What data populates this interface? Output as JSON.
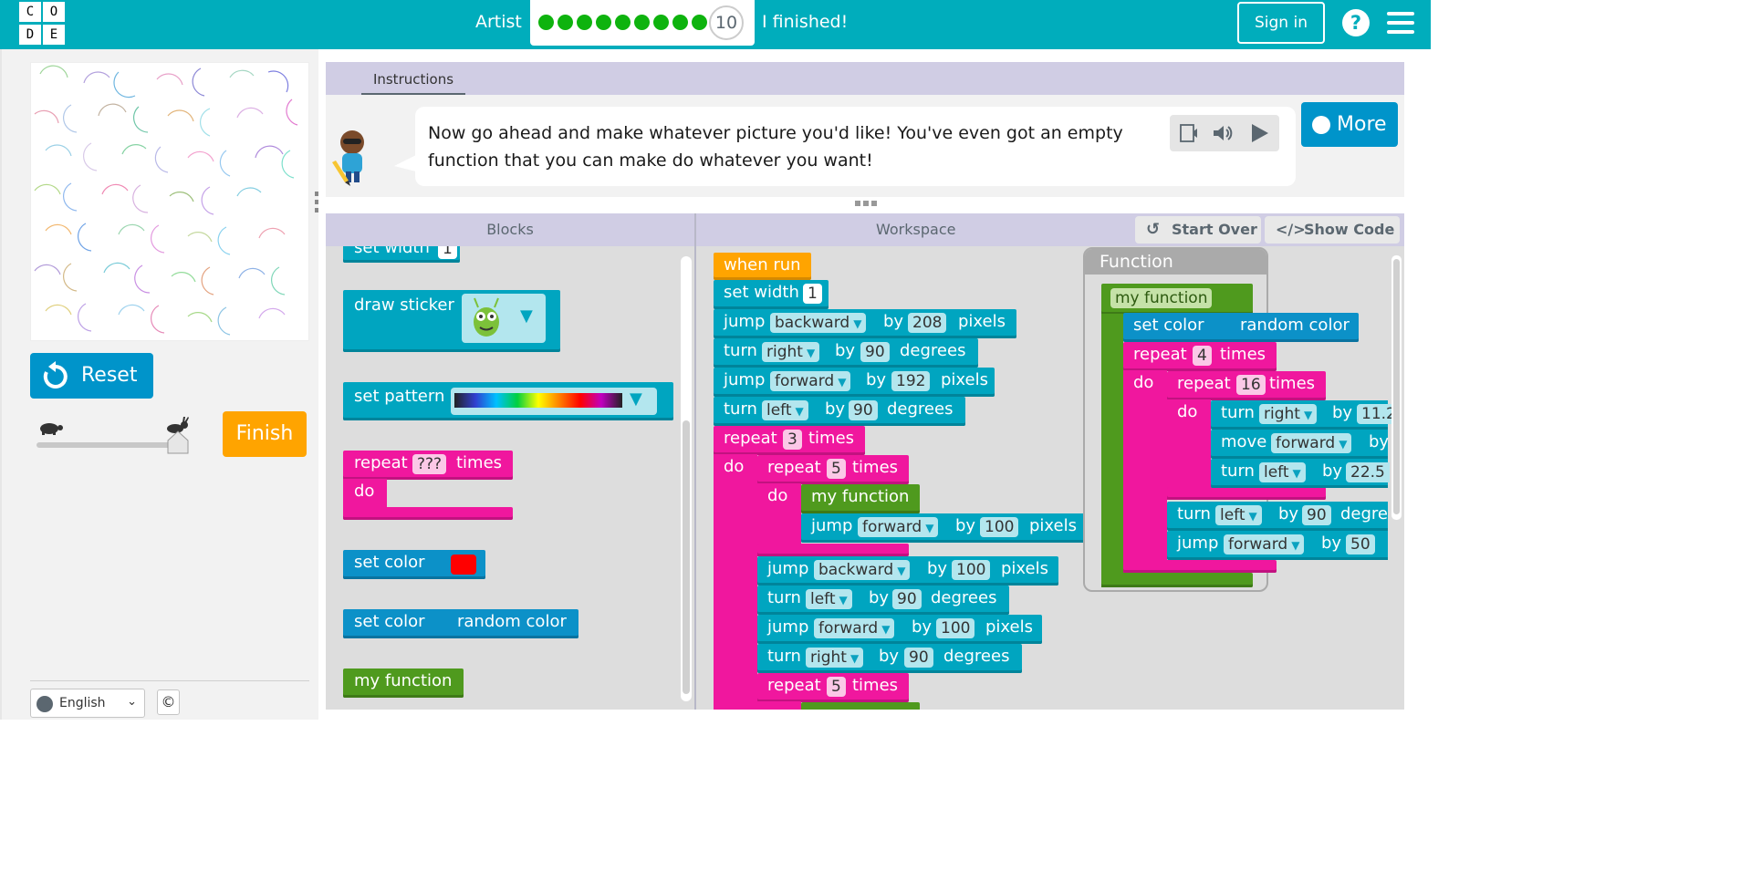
{
  "header": {
    "logo_letters": [
      "C",
      "O",
      "D",
      "E"
    ],
    "level_name": "Artist",
    "progress_dots": 9,
    "current_level": "10",
    "finished_text": "I finished!",
    "signin_label": "Sign in",
    "help_glyph": "?"
  },
  "left": {
    "reset_label": "Reset",
    "finish_label": "Finish",
    "speed_level": 1.0,
    "language": "English",
    "copyright_glyph": "©"
  },
  "instructions": {
    "tab_label": "Instructions",
    "line1": "Now go ahead and make whatever picture you'd like! You've even got an empty",
    "line2": "function that you can make do whatever you want!",
    "more_label": "More"
  },
  "blockly": {
    "blocks_header": "Blocks",
    "workspace_header": "Workspace",
    "start_over_label": "Start Over",
    "show_code_label": "Show Code",
    "toolbox": {
      "set_width": "set width",
      "set_width_val": "1",
      "draw_sticker": "draw sticker",
      "set_pattern": "set pattern",
      "repeat": "repeat",
      "repeat_val": "???",
      "times": "times",
      "do": "do",
      "set_color": "set color",
      "random_color": "random color",
      "my_function": "my function"
    },
    "workspace": {
      "when_run": "when run",
      "set_width": "set width",
      "width_val": "1",
      "jump": "jump",
      "turn": "turn",
      "move": "move",
      "backward": "backward",
      "forward": "forward",
      "right": "right",
      "left": "left",
      "by": "by",
      "pixels": "pixels",
      "degrees": "degrees",
      "repeat": "repeat",
      "times": "times",
      "do": "do",
      "my_function": "my function",
      "set_color": "set color",
      "random_color": "random color",
      "n208": "208",
      "n90": "90",
      "n192": "192",
      "n3": "3",
      "n5": "5",
      "n100": "100",
      "n4": "4",
      "n16": "16",
      "n11": "11.2",
      "n22": "22.5",
      "n50": "50",
      "degre": "degre",
      "by_cut": "by"
    },
    "function_title": "Function"
  }
}
